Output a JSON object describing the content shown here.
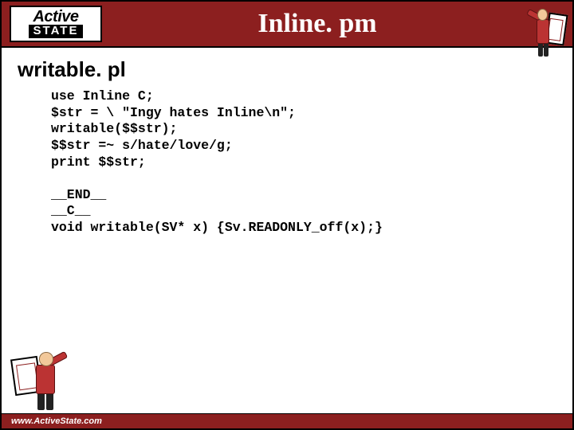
{
  "header": {
    "logo_top": "Active",
    "logo_bottom": "STATE",
    "title": "Inline. pm"
  },
  "subtitle": "writable. pl",
  "code": "use Inline C;\n$str = \\ \"Ingy hates Inline\\n\";\nwritable($$str);\n$$str =~ s/hate/love/g;\nprint $$str;\n\n__END__\n__C__\nvoid writable(SV* x) {Sv.READONLY_off(x);}",
  "footer": {
    "url": "www.ActiveState.com"
  },
  "icons": {
    "corner": "painter-figure-icon",
    "footer": "painter-figure-icon"
  }
}
